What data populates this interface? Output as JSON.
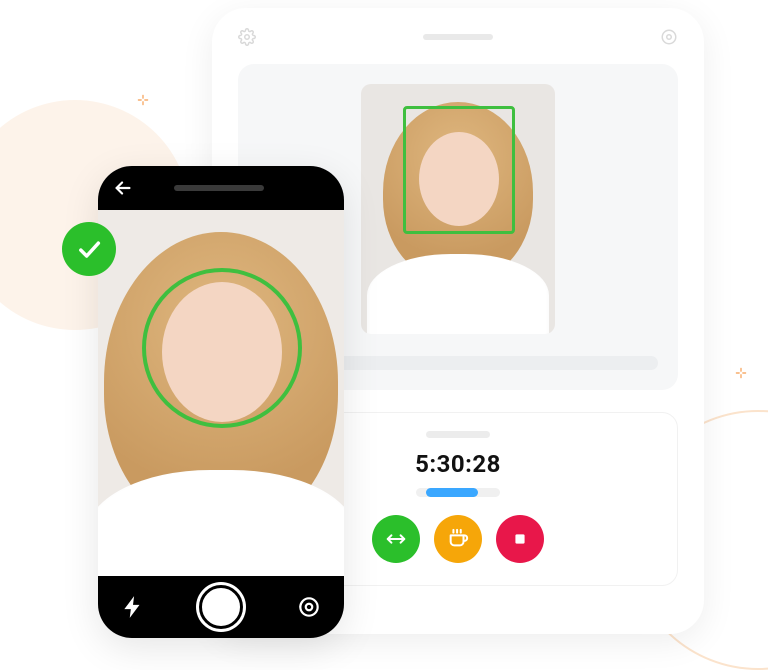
{
  "colors": {
    "success": "#2bbf2b",
    "warning": "#f6a609",
    "danger": "#e8174a",
    "progress": "#3aa7ff",
    "face_outline": "#3fbf3f"
  },
  "tablet": {
    "icons": {
      "settings": "gear-icon",
      "selfie_switch": "selfie-switch-icon"
    },
    "face_detection": {
      "shape": "rectangle",
      "detected": true
    },
    "timer": {
      "value": "5:30:28",
      "progress_percent": 62
    },
    "actions": {
      "swap_label": "swap",
      "break_label": "break",
      "stop_label": "stop"
    }
  },
  "phone": {
    "navbar": {
      "back": "back"
    },
    "face_detection": {
      "shape": "circle",
      "detected": true
    },
    "controls": {
      "flash": "flash",
      "shutter": "shutter",
      "flip": "flip-camera"
    }
  },
  "badge": {
    "state": "verified"
  }
}
